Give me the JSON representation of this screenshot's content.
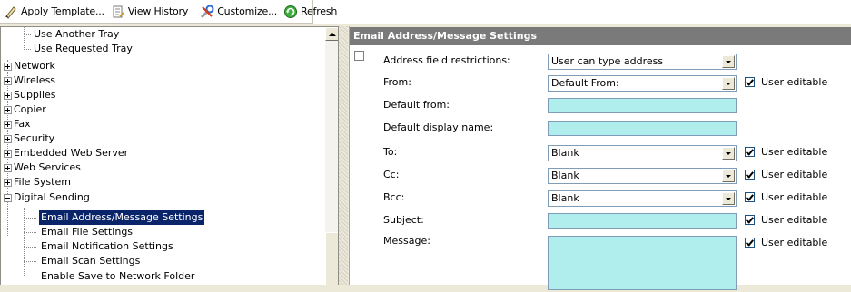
{
  "toolbar": {
    "buttons": [
      {
        "label": "Apply Template...",
        "icon": "apply-template-icon"
      },
      {
        "label": "View History",
        "icon": "view-history-icon"
      },
      {
        "label": "Customize...",
        "icon": "customize-icon"
      },
      {
        "label": "Refresh",
        "icon": "refresh-icon"
      }
    ]
  },
  "tree": {
    "items": [
      {
        "label": "Use Another Tray"
      },
      {
        "label": "Use Requested Tray"
      },
      {
        "label": "Network"
      },
      {
        "label": "Wireless"
      },
      {
        "label": "Supplies"
      },
      {
        "label": "Copier"
      },
      {
        "label": "Fax"
      },
      {
        "label": "Security"
      },
      {
        "label": "Embedded Web Server"
      },
      {
        "label": "Web Services"
      },
      {
        "label": "File System"
      },
      {
        "label": "Digital Sending"
      },
      {
        "label": "Email Address/Message Settings"
      },
      {
        "label": "Email File Settings"
      },
      {
        "label": "Email Notification Settings"
      },
      {
        "label": "Email Scan Settings"
      },
      {
        "label": "Enable Save to Network Folder"
      }
    ]
  },
  "panel": {
    "title": "Email Address/Message Settings",
    "enable_checked": false,
    "user_editable_label": "User editable",
    "fields": {
      "address_restrictions": {
        "label": "Address field restrictions:",
        "value": "User can type address"
      },
      "from": {
        "label": "From:",
        "value": "Default From:",
        "user_editable": true
      },
      "default_from": {
        "label": "Default from:",
        "value": ""
      },
      "default_display_name": {
        "label": "Default display name:",
        "value": ""
      },
      "to": {
        "label": "To:",
        "value": "Blank",
        "user_editable": true
      },
      "cc": {
        "label": "Cc:",
        "value": "Blank",
        "user_editable": true
      },
      "bcc": {
        "label": "Bcc:",
        "value": "Blank",
        "user_editable": true
      },
      "subject": {
        "label": "Subject:",
        "value": "",
        "user_editable": true
      },
      "message": {
        "label": "Message:",
        "value": "",
        "user_editable": true
      }
    }
  },
  "colors": {
    "selection": "#0a246a",
    "panel_header": "#7a7a7a",
    "text_field": "#b0eeee"
  }
}
